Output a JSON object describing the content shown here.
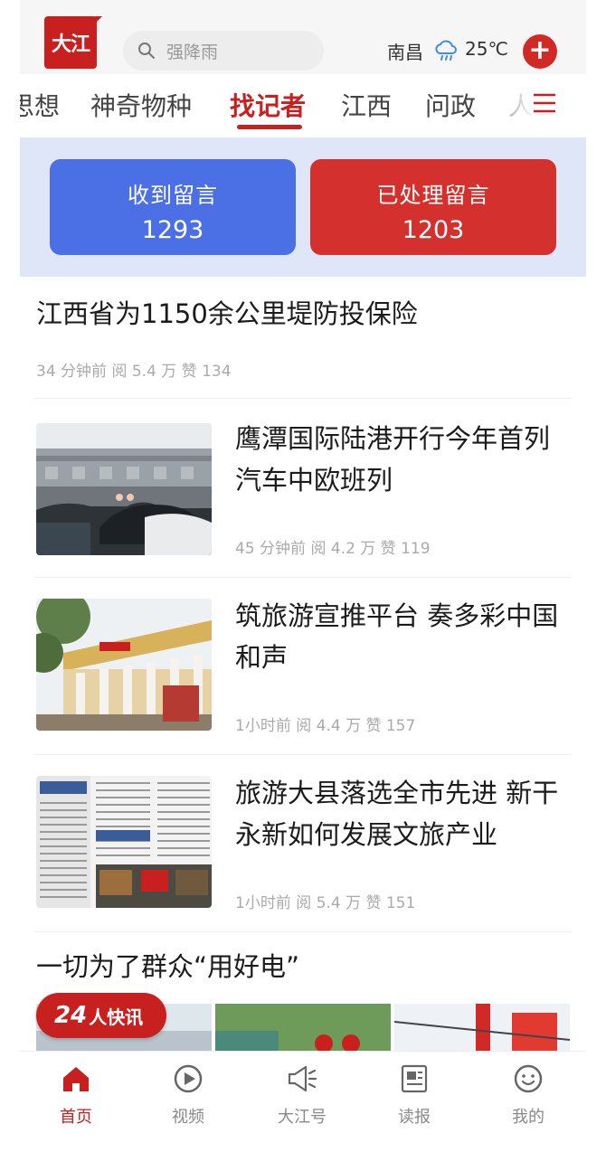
{
  "header": {
    "logo_text": "大江",
    "search_placeholder": "强降雨",
    "city": "南昌",
    "temperature": "25℃",
    "add_icon": "plus-icon",
    "accent_color": "#c8201f"
  },
  "tabs": [
    {
      "label": "思想"
    },
    {
      "label": "神奇物种"
    },
    {
      "label": "找记者",
      "active": true
    },
    {
      "label": "江西"
    },
    {
      "label": "问政"
    },
    {
      "label": "人"
    }
  ],
  "stats": {
    "received": {
      "label": "收到留言",
      "value": "1293",
      "color": "#4b6fe4"
    },
    "processed": {
      "label": "已处理留言",
      "value": "1203",
      "color": "#d4302d"
    }
  },
  "news": [
    {
      "title": "江西省为1150余公里堤防投保险",
      "meta": "34 分钟前  阅 5.4 万  赞 134"
    },
    {
      "title": "鹰潭国际陆港开行今年首列汽车中欧班列",
      "meta": "45 分钟前  阅 4.2 万  赞 119"
    },
    {
      "title": "筑旅游宣推平台 奏多彩中国和声",
      "meta": "1小时前  阅 4.4 万  赞 157"
    },
    {
      "title": "旅游大县落选全市先进 新干永新如何发展文旅产业",
      "meta": "1小时前  阅 5.4 万  赞 151"
    },
    {
      "title": "一切为了群众“用好电”"
    }
  ],
  "badge": {
    "number": "24",
    "text": "人快讯"
  },
  "bottom_nav": [
    {
      "label": "首页",
      "icon": "home-icon",
      "active": true
    },
    {
      "label": "视频",
      "icon": "play-icon"
    },
    {
      "label": "大江号",
      "icon": "megaphone-icon"
    },
    {
      "label": "读报",
      "icon": "newspaper-icon"
    },
    {
      "label": "我的",
      "icon": "smile-icon"
    }
  ]
}
